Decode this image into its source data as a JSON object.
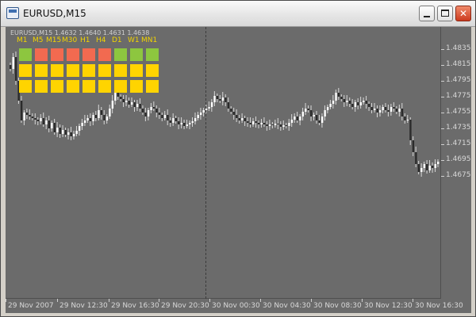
{
  "window": {
    "title": "EURUSD,M15",
    "close_label": "✕"
  },
  "chart": {
    "ohlc_text": "EURUSD,M15  1.4632 1.4640 1.4631 1.4638",
    "timeframes": [
      "M1",
      "M5",
      "M15",
      "M30",
      "H1",
      "H4",
      "D1",
      "W1",
      "MN1"
    ],
    "signal_grid": [
      [
        "green",
        "red",
        "red",
        "red",
        "red",
        "red",
        "green",
        "green",
        "green"
      ],
      [
        "yellow",
        "yellow",
        "yellow",
        "yellow",
        "yellow",
        "yellow",
        "yellow",
        "yellow",
        "yellow"
      ],
      [
        "yellow",
        "yellow",
        "yellow",
        "yellow",
        "yellow",
        "yellow",
        "yellow",
        "yellow",
        "yellow"
      ]
    ],
    "colors": {
      "green": "#8dc63f",
      "red": "#f26a50",
      "yellow": "#ffd400",
      "bull_body": "#ffffff",
      "bear_body": "#2b2b2b",
      "wick": "#d8d8d8",
      "background": "#6b6b6b"
    },
    "price_labels": [
      "1.4835",
      "1.4815",
      "1.4795",
      "1.4775",
      "1.4755",
      "1.4735",
      "1.4715",
      "1.4695",
      "1.4675"
    ],
    "time_labels": [
      "29 Nov 2007",
      "29 Nov 12:30",
      "29 Nov 16:30",
      "29 Nov 20:30",
      "30 Nov 00:30",
      "30 Nov 04:30",
      "30 Nov 08:30",
      "30 Nov 12:30",
      "30 Nov 16:30"
    ]
  },
  "chart_data": {
    "type": "candlestick",
    "title": "EURUSD,M15",
    "xlabel": "",
    "ylabel": "",
    "ylim": [
      1.4665,
      1.485
    ],
    "grid": false,
    "close": [
      1.481,
      1.4825,
      1.4795,
      1.477,
      1.4745,
      1.4755,
      1.4752,
      1.475,
      1.4748,
      1.4746,
      1.4744,
      1.4748,
      1.474,
      1.4745,
      1.4735,
      1.4742,
      1.473,
      1.4736,
      1.4728,
      1.4733,
      1.4727,
      1.473,
      1.4725,
      1.4728,
      1.4732,
      1.4738,
      1.4742,
      1.4745,
      1.4748,
      1.4744,
      1.4752,
      1.4748,
      1.4758,
      1.4752,
      1.4745,
      1.475,
      1.476,
      1.477,
      1.478,
      1.4775,
      1.4772,
      1.4768,
      1.477,
      1.4765,
      1.4768,
      1.4762,
      1.4766,
      1.476,
      1.4755,
      1.475,
      1.4758,
      1.4762,
      1.476,
      1.4755,
      1.4752,
      1.4748,
      1.4752,
      1.4745,
      1.4742,
      1.4748,
      1.4744,
      1.474,
      1.4742,
      1.4738,
      1.474,
      1.4742,
      1.4744,
      1.4748,
      1.4752,
      1.4755,
      1.4758,
      1.476,
      1.4762,
      1.4768,
      1.4776,
      1.4772,
      1.477,
      1.4774,
      1.4768,
      1.476,
      1.4756,
      1.4752,
      1.4748,
      1.4745,
      1.4748,
      1.4744,
      1.4742,
      1.474,
      1.4744,
      1.4742,
      1.474,
      1.4742,
      1.474,
      1.4738,
      1.474,
      1.4739,
      1.4741,
      1.474,
      1.4737,
      1.4739,
      1.4738,
      1.4742,
      1.4746,
      1.475,
      1.4745,
      1.475,
      1.4756,
      1.476,
      1.4758,
      1.475,
      1.4752,
      1.4745,
      1.4742,
      1.475,
      1.4758,
      1.4762,
      1.4766,
      1.477,
      1.478,
      1.4775,
      1.4772,
      1.4768,
      1.477,
      1.4766,
      1.4762,
      1.4768,
      1.4764,
      1.4768,
      1.477,
      1.4766,
      1.4762,
      1.4758,
      1.476,
      1.4755,
      1.4758,
      1.4762,
      1.4758,
      1.4756,
      1.4762,
      1.476,
      1.4756,
      1.476,
      1.475,
      1.4745,
      1.4746,
      1.472,
      1.4705,
      1.469,
      1.468,
      1.4685,
      1.469,
      1.4682,
      1.4688,
      1.4685,
      1.469,
      1.4693
    ]
  }
}
